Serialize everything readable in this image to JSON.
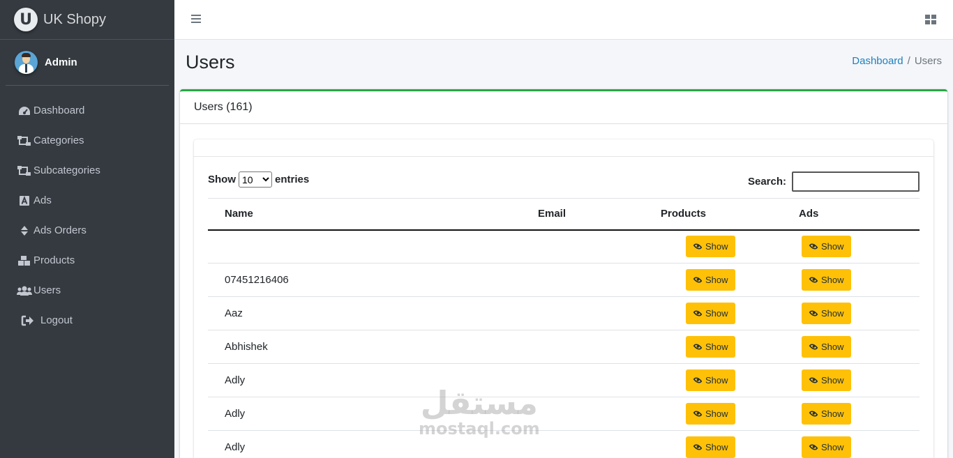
{
  "brand": {
    "logo_letter": "U",
    "name": "UK Shopy"
  },
  "user": {
    "name": "Admin"
  },
  "sidebar": {
    "items": [
      {
        "label": "Dashboard",
        "icon": "tachometer-icon"
      },
      {
        "label": "Categories",
        "icon": "sitemap-icon"
      },
      {
        "label": "Subcategories",
        "icon": "sitemap-icon"
      },
      {
        "label": "Ads",
        "icon": "ad-icon"
      },
      {
        "label": "Ads Orders",
        "icon": "sort-icon"
      },
      {
        "label": "Products",
        "icon": "boxes-icon"
      },
      {
        "label": "Users",
        "icon": "users-icon"
      },
      {
        "label": "Logout",
        "icon": "sign-out-icon"
      }
    ]
  },
  "page": {
    "title": "Users"
  },
  "breadcrumb": {
    "home": "Dashboard",
    "separator": "/",
    "current": "Users"
  },
  "card": {
    "title": "Users (161)"
  },
  "table_controls": {
    "show_label": "Show",
    "entries_label": "entries",
    "page_length": "10",
    "search_label": "Search:",
    "search_value": ""
  },
  "table": {
    "columns": [
      "Name",
      "Email",
      "Products",
      "Ads"
    ],
    "button_label": "Show",
    "rows": [
      {
        "name": "",
        "email": ""
      },
      {
        "name": "07451216406",
        "email": ""
      },
      {
        "name": "Aaz",
        "email": ""
      },
      {
        "name": "Abhishek",
        "email": ""
      },
      {
        "name": "Adly",
        "email": ""
      },
      {
        "name": "Adly",
        "email": ""
      },
      {
        "name": "Adly",
        "email": ""
      }
    ]
  },
  "watermark": {
    "arabic": "مستقل",
    "latin": "mostaql.com"
  },
  "colors": {
    "sidebar": "#343a40",
    "accent": "#28a745",
    "button": "#ffc107",
    "link": "#1f7fbf"
  }
}
